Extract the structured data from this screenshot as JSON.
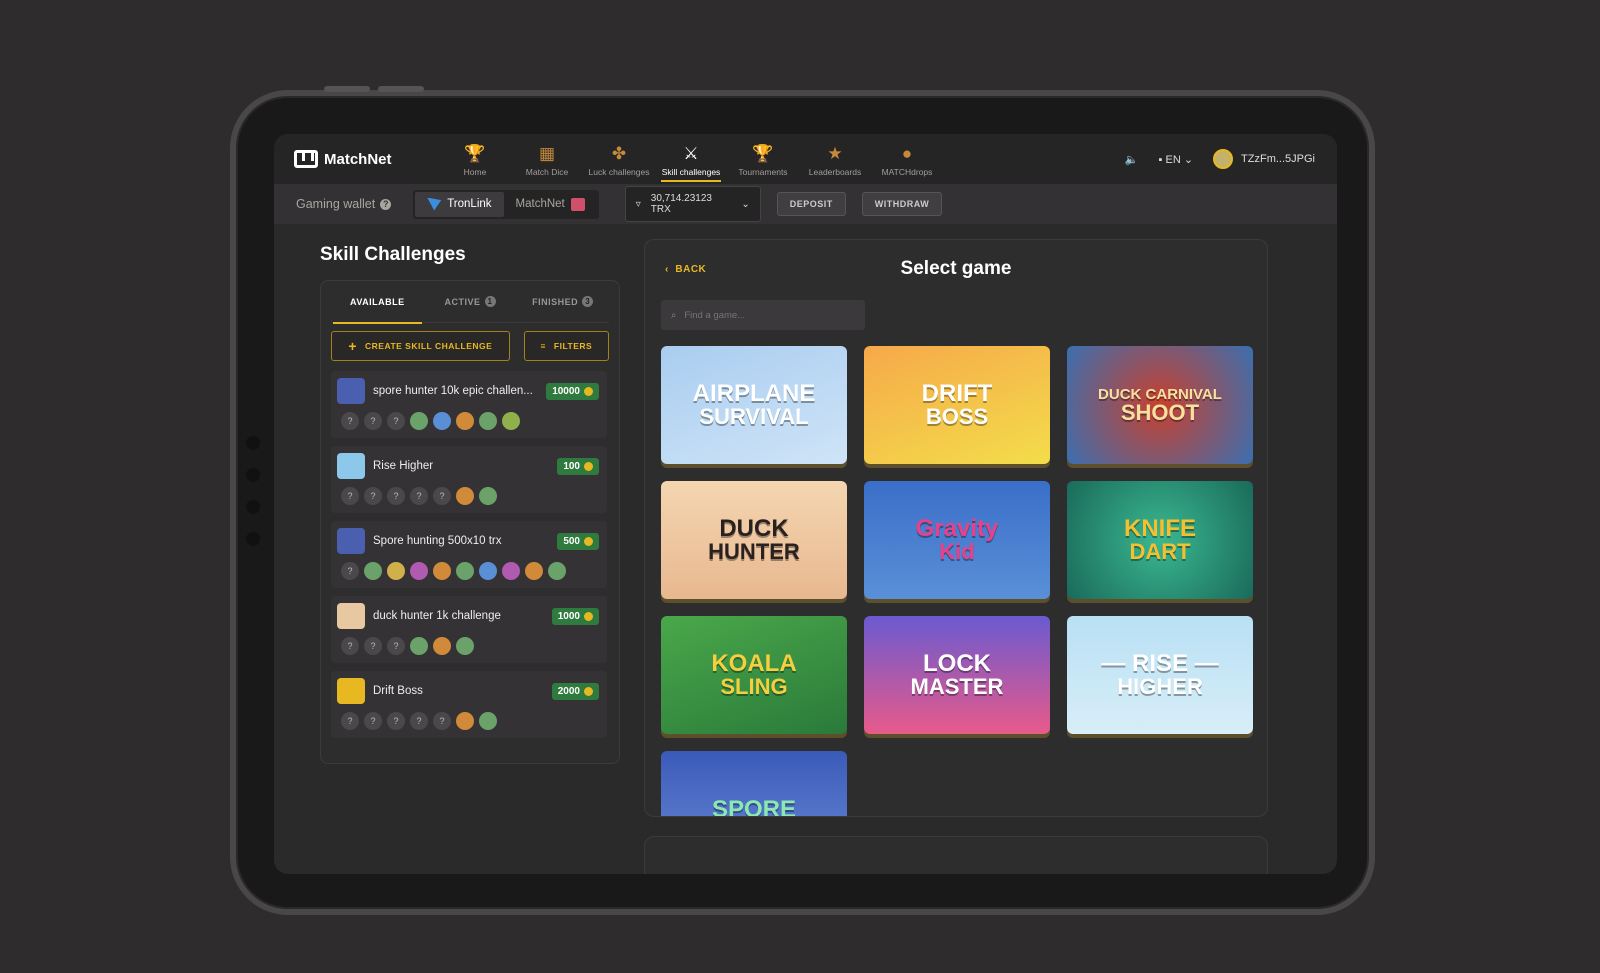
{
  "app": {
    "logo_text": "MatchNet"
  },
  "nav": {
    "items": [
      {
        "label": "Home",
        "icon": "🏆",
        "icon_name": "trophy-key-icon"
      },
      {
        "label": "Match Dice",
        "icon": "▦",
        "icon_name": "dice-icon"
      },
      {
        "label": "Luck challenges",
        "icon": "✤",
        "icon_name": "clover-icon"
      },
      {
        "label": "Skill challenges",
        "icon": "⚔",
        "icon_name": "crossed-swords-icon"
      },
      {
        "label": "Tournaments",
        "icon": "🏆",
        "icon_name": "trophy-icon"
      },
      {
        "label": "Leaderboards",
        "icon": "★",
        "icon_name": "star-icon"
      },
      {
        "label": "MATCHdrops",
        "icon": "●",
        "icon_name": "coin-icon"
      }
    ],
    "active_index": 3,
    "lang": "EN",
    "user": "TZzFm...5JPGi"
  },
  "wallet": {
    "label": "Gaming wallet",
    "tab_tronlink": "TronLink",
    "tab_matchnet": "MatchNet",
    "balance": "30,714.23123 TRX",
    "deposit": "DEPOSIT",
    "withdraw": "WITHDRAW"
  },
  "skill": {
    "title": "Skill Challenges",
    "tab_available": "AVAILABLE",
    "tab_active": "ACTIVE",
    "tab_active_count": "1",
    "tab_finished": "FINISHED",
    "tab_finished_count": "3",
    "create_label": "CREATE SKILL CHALLENGE",
    "filters_label": "FILTERS",
    "challenges": [
      {
        "name": "spore hunter 10k epic challen...",
        "prize": "10000",
        "thumb": "#4a5fb0",
        "unknown": 3,
        "players": [
          "#6aa26a",
          "#5a8fd6",
          "#d08a3a",
          "#6aa26a",
          "#8fb04a"
        ]
      },
      {
        "name": "Rise Higher",
        "prize": "100",
        "thumb": "#8cc8ea",
        "unknown": 5,
        "players": [
          "#d08a3a",
          "#6aa26a"
        ]
      },
      {
        "name": "Spore hunting 500x10 trx",
        "prize": "500",
        "thumb": "#4a5fb0",
        "unknown": 1,
        "players": [
          "#6aa26a",
          "#d0b04a",
          "#b05ab0",
          "#d08a3a",
          "#6aa26a",
          "#5a8fd6",
          "#b05ab0",
          "#d08a3a",
          "#6aa26a"
        ]
      },
      {
        "name": "duck hunter 1k challenge",
        "prize": "1000",
        "thumb": "#e8c8a0",
        "unknown": 3,
        "players": [
          "#6aa26a",
          "#d08a3a",
          "#6aa26a"
        ]
      },
      {
        "name": "Drift Boss",
        "prize": "2000",
        "thumb": "#e8b823",
        "unknown": 5,
        "players": [
          "#d08a3a",
          "#6aa26a"
        ]
      }
    ]
  },
  "select": {
    "back": "BACK",
    "title": "Select game",
    "search_placeholder": "Find a game...",
    "games": [
      {
        "line1": "AIRPLANE",
        "line2": "SURVIVAL",
        "bg": "linear-gradient(160deg,#a9cdf0,#cfe4f7)",
        "color": "#ffffff"
      },
      {
        "line1": "DRIFT",
        "line2": "BOSS",
        "bg": "linear-gradient(160deg,#f6a94a,#f3dd4a)",
        "color": "#ffffff"
      },
      {
        "line1": "DUCK CARNIVAL",
        "line2": "SHOOT",
        "bg": "radial-gradient(circle,#c8402e,#3a6fb0)",
        "color": "#f8e0a0"
      },
      {
        "line1": "DUCK",
        "line2": "HUNTER",
        "bg": "linear-gradient(180deg,#f4d6b0,#e8b890)",
        "color": "#2a2020"
      },
      {
        "line1": "Gravity",
        "line2": "Kid",
        "bg": "linear-gradient(180deg,#3a6fc8,#5a8fd8)",
        "color": "#e8418a"
      },
      {
        "line1": "KNIFE",
        "line2": "DART",
        "bg": "radial-gradient(circle,#3ab890,#1a6a5a)",
        "color": "#f4c030"
      },
      {
        "line1": "KOALA",
        "line2": "SLING",
        "bg": "linear-gradient(160deg,#4aa84a,#2a7a3a)",
        "color": "#f4d040"
      },
      {
        "line1": "LOCK",
        "line2": "MASTER",
        "bg": "linear-gradient(180deg,#6a5ad0,#e85a8a)",
        "color": "#ffffff"
      },
      {
        "line1": "— RISE —",
        "line2": "HIGHER",
        "bg": "linear-gradient(180deg,#b8e0f4,#d8eef8)",
        "color": "#ffffff"
      },
      {
        "line1": "SPORE",
        "line2": "",
        "bg": "linear-gradient(180deg,#3a5ab8,#6a8ad8)",
        "color": "#8ae8b0"
      }
    ]
  }
}
